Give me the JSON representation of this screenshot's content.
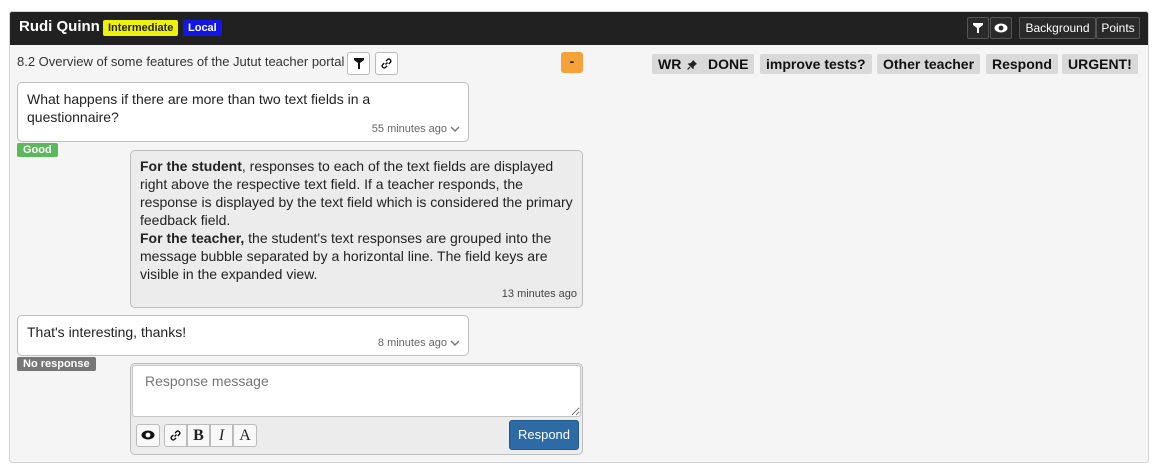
{
  "header": {
    "student_name": "Rudi Quinn",
    "level_badge": "Intermediate",
    "location_badge": "Local",
    "filter_icon": "filter-icon",
    "eye_icon": "eye-icon",
    "background_label": "Background",
    "points_label": "Points"
  },
  "exercise": {
    "title": "8.2 Overview of some features of the Jutut teacher portal",
    "filter_icon": "filter-icon",
    "link_icon": "link-icon",
    "toggle_label": "-"
  },
  "tags": [
    "WR",
    "DONE",
    "improve tests?",
    "Other teacher",
    "Respond",
    "URGENT!"
  ],
  "pin_icon": "pin-icon",
  "messages": {
    "q1": {
      "text": "What happens if there are more than two text fields in a questionnaire?",
      "time": "55 minutes ago",
      "status": "Good"
    },
    "answer": {
      "p1_bold": "For the student",
      "p1_rest": ", responses to each of the text fields are displayed right above the respective text field. If a teacher responds, the response is displayed by the text field which is considered the primary feedback field.",
      "p2_bold": "For the teacher,",
      "p2_rest": " the student's text responses are grouped into the message bubble separated by a horizontal line. The field keys are visible in the expanded view.",
      "time": "13 minutes ago"
    },
    "q2": {
      "text": "That's interesting, thanks!",
      "time": "8 minutes ago",
      "status": "No response"
    }
  },
  "response": {
    "placeholder": "Response message",
    "bold_label": "B",
    "italic_label": "I",
    "font_label": "A",
    "respond_label": "Respond"
  },
  "colors": {
    "topbar": "#212121",
    "level_badge": "#eef20a",
    "local_badge": "#1216e6",
    "good": "#5cb85c",
    "no_response": "#777777",
    "orange": "#f5a23a",
    "respond_button": "#2d6ba7"
  }
}
